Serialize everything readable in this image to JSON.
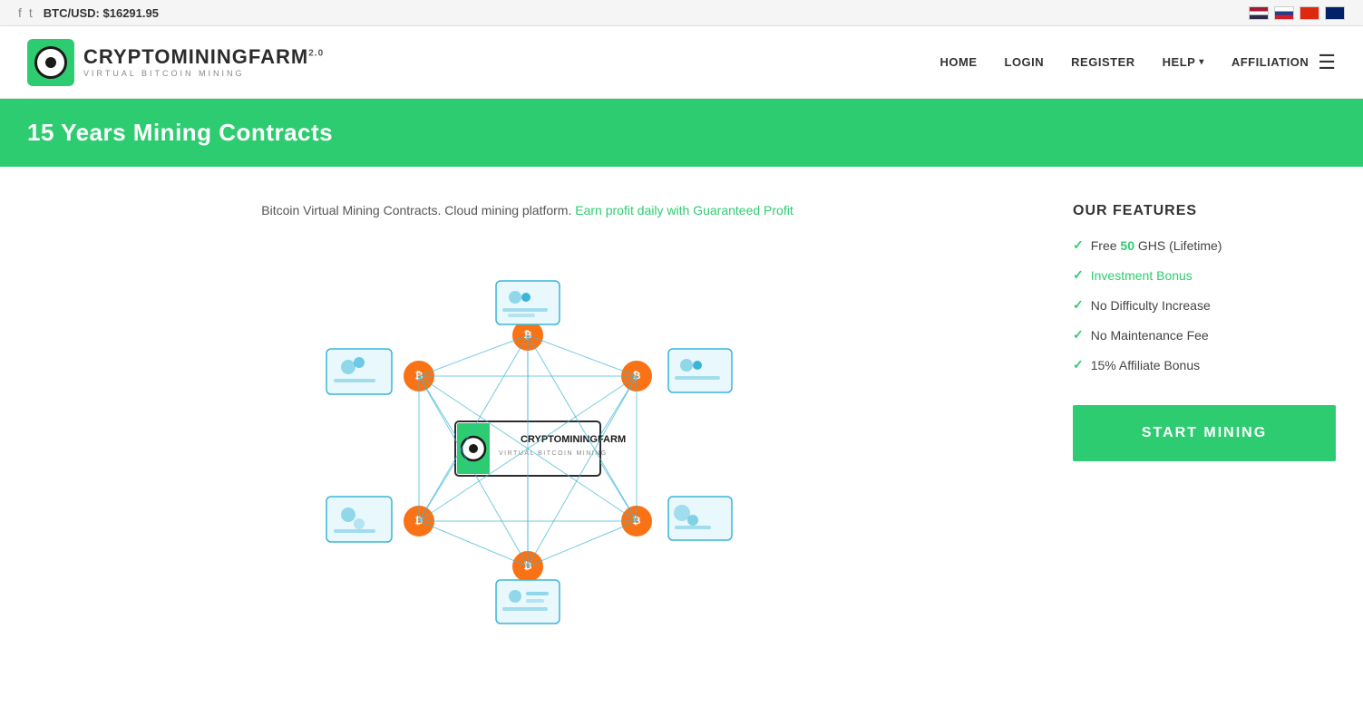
{
  "topbar": {
    "btc_label": "BTC/USD:",
    "btc_price": "$16291.95"
  },
  "navbar": {
    "logo_main": "CRYPTOMININGFARM",
    "logo_sup": "2.0",
    "logo_sub": "VIRTUAL BITCOIN MINING",
    "nav_items": [
      {
        "label": "HOME",
        "id": "home"
      },
      {
        "label": "LOGIN",
        "id": "login"
      },
      {
        "label": "REGISTER",
        "id": "register"
      },
      {
        "label": "HELP",
        "id": "help",
        "has_arrow": true
      },
      {
        "label": "AFFILIATION",
        "id": "affiliation"
      }
    ]
  },
  "banner": {
    "title": "15 Years Mining Contracts"
  },
  "main": {
    "tagline": "Bitcoin Virtual Mining Contracts. Cloud mining platform. Earn profit daily with Guaranteed Profit",
    "tagline_highlight": "Earn profit daily with Guaranteed Profit"
  },
  "features": {
    "title": "OUR FEATURES",
    "items": [
      {
        "text": " Free ",
        "highlight": "50",
        "suffix": " GHS (Lifetime)"
      },
      {
        "text": "Investment Bonus",
        "green": true
      },
      {
        "text": "No Difficulty Increase"
      },
      {
        "text": "No Maintenance Fee"
      },
      {
        "text": "15% Affiliate Bonus"
      }
    ],
    "cta_button": "START MINING"
  }
}
